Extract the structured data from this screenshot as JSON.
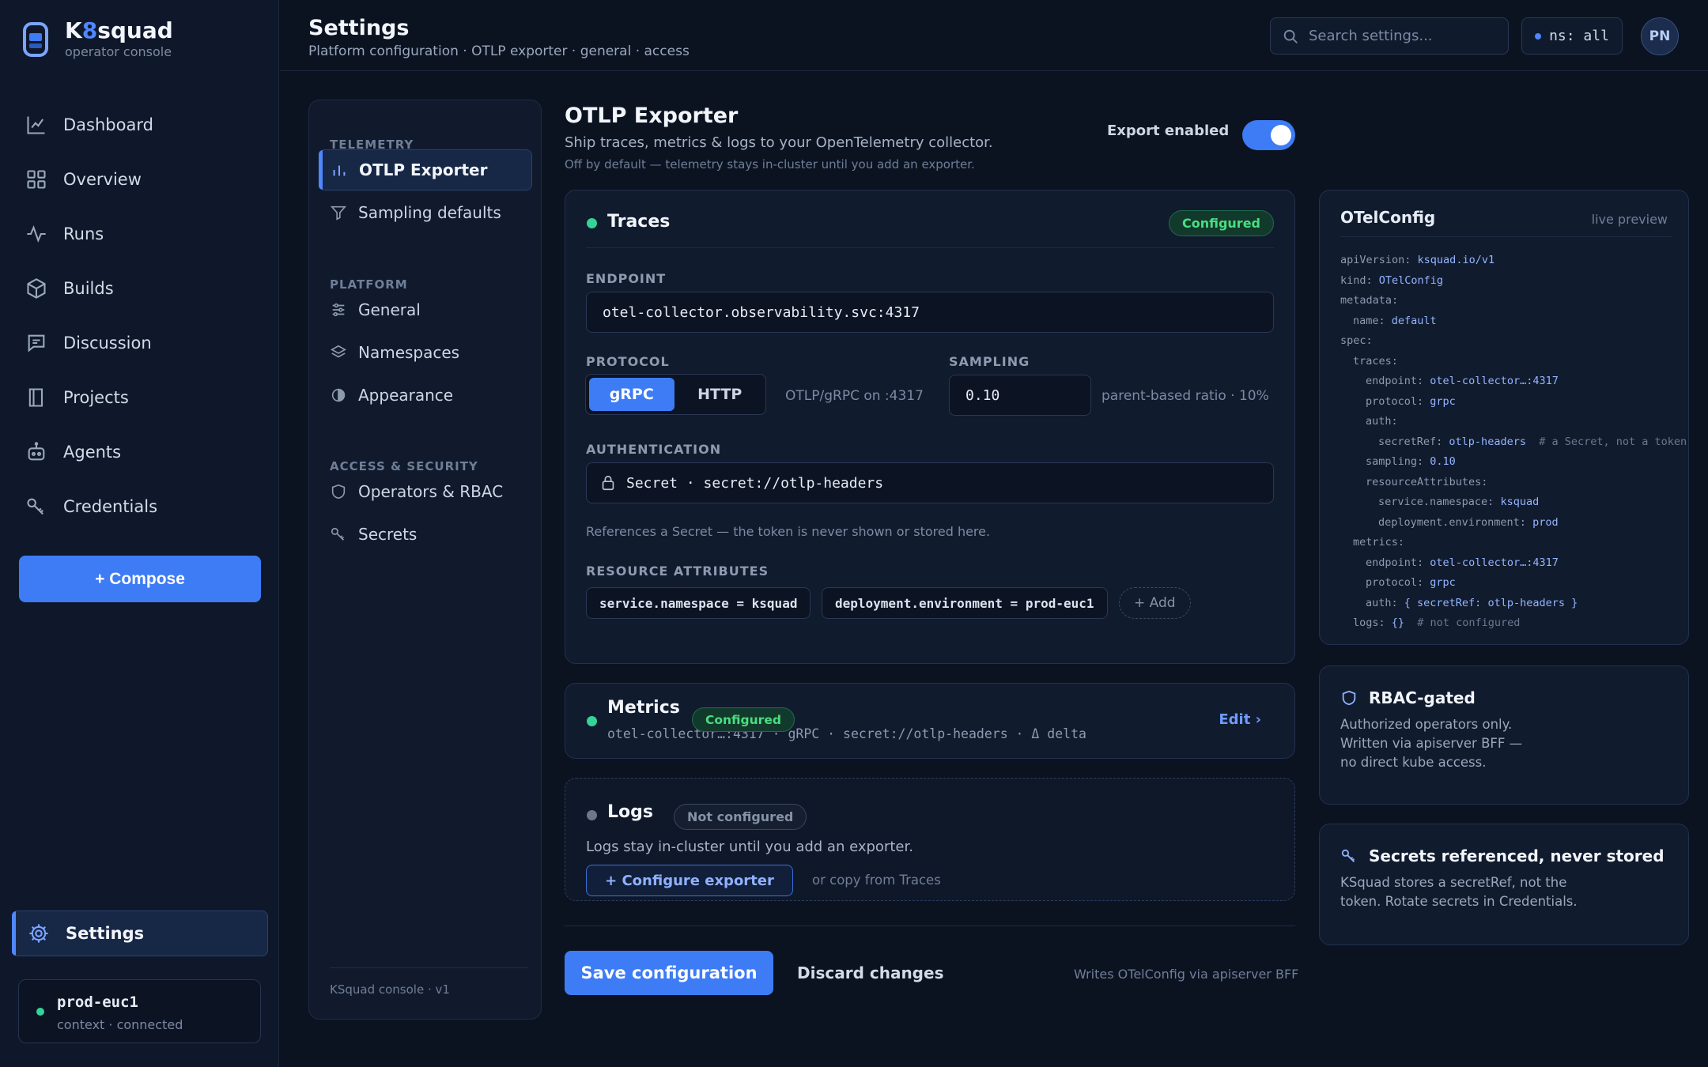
{
  "brand": {
    "name_a": "K",
    "name_accent": "8",
    "name_b": "squad",
    "subtitle": "operator console"
  },
  "nav": {
    "items": [
      {
        "label": "Dashboard",
        "icon": "chart-line-icon"
      },
      {
        "label": "Overview",
        "icon": "grid-icon"
      },
      {
        "label": "Runs",
        "icon": "activity-icon"
      },
      {
        "label": "Builds",
        "icon": "box-icon"
      },
      {
        "label": "Discussion",
        "icon": "message-icon"
      },
      {
        "label": "Projects",
        "icon": "book-icon"
      },
      {
        "label": "Agents",
        "icon": "bot-icon"
      },
      {
        "label": "Credentials",
        "icon": "key-icon"
      }
    ],
    "compose_label": "+ Compose",
    "settings_label": "Settings"
  },
  "context": {
    "name": "prod-euc1",
    "status": "context · connected"
  },
  "header": {
    "title": "Settings",
    "breadcrumb": "Platform configuration · OTLP exporter · general · access",
    "search_placeholder": "Search settings...",
    "ns_label": "ns: all",
    "avatar_initials": "PN"
  },
  "subnav": {
    "sections": [
      {
        "title": "TELEMETRY",
        "items": [
          "OTLP Exporter",
          "Sampling defaults"
        ]
      },
      {
        "title": "PLATFORM",
        "items": [
          "General",
          "Namespaces",
          "Appearance"
        ]
      },
      {
        "title": "ACCESS & SECURITY",
        "items": [
          "Operators & RBAC",
          "Secrets"
        ]
      }
    ],
    "footer": "KSquad console · v1"
  },
  "section": {
    "title": "OTLP Exporter",
    "subtitle": "Ship traces, metrics & logs to your OpenTelemetry collector.",
    "note": "Off by default — telemetry stays in-cluster until you add an exporter.",
    "export_label": "Export enabled",
    "export_enabled": true
  },
  "traces": {
    "title": "Traces",
    "status": "Configured",
    "endpoint_label": "ENDPOINT",
    "endpoint": "otel-collector.observability.svc:4317",
    "protocol_label": "PROTOCOL",
    "protocol_options": [
      "gRPC",
      "HTTP"
    ],
    "protocol_selected": "gRPC",
    "protocol_hint": "OTLP/gRPC on :4317",
    "sampling_label": "SAMPLING",
    "sampling_value": "0.10",
    "sampling_hint": "parent-based ratio · 10%",
    "auth_label": "AUTHENTICATION",
    "auth_value": "Secret · secret://otlp-headers",
    "auth_hint": "References a Secret — the token is never shown or stored here.",
    "attrs_label": "RESOURCE ATTRIBUTES",
    "attrs": [
      "service.namespace = ksquad",
      "deployment.environment = prod-euc1"
    ],
    "add_label": "+ Add"
  },
  "metrics": {
    "title": "Metrics",
    "status": "Configured",
    "summary": "otel-collector…:4317 · gRPC · secret://otlp-headers · Δ delta",
    "edit_label": "Edit ›"
  },
  "logs": {
    "title": "Logs",
    "status": "Not configured",
    "text": "Logs stay in-cluster until you add an exporter.",
    "configure_label": "+ Configure exporter",
    "copy_hint": "or copy from Traces"
  },
  "actions": {
    "save_label": "Save configuration",
    "discard_label": "Discard changes",
    "note": "Writes OTelConfig via apiserver BFF"
  },
  "preview": {
    "title": "OTelConfig",
    "live_label": "live preview",
    "lines": [
      {
        "indent": 0,
        "key": "apiVersion:",
        "value": "ksquad.io/v1",
        "comment": ""
      },
      {
        "indent": 0,
        "key": "kind:",
        "value": "OTelConfig",
        "comment": ""
      },
      {
        "indent": 0,
        "key": "metadata:",
        "value": "",
        "comment": ""
      },
      {
        "indent": 1,
        "key": "name:",
        "value": "default",
        "comment": ""
      },
      {
        "indent": 0,
        "key": "spec:",
        "value": "",
        "comment": ""
      },
      {
        "indent": 1,
        "key": "traces:",
        "value": "",
        "comment": ""
      },
      {
        "indent": 2,
        "key": "endpoint:",
        "value": "otel-collector…:4317",
        "comment": ""
      },
      {
        "indent": 2,
        "key": "protocol:",
        "value": "grpc",
        "comment": ""
      },
      {
        "indent": 2,
        "key": "auth:",
        "value": "",
        "comment": ""
      },
      {
        "indent": 3,
        "key": "secretRef:",
        "value": "otlp-headers",
        "comment": "  # a Secret, not a token"
      },
      {
        "indent": 2,
        "key": "sampling:",
        "value": "0.10",
        "comment": ""
      },
      {
        "indent": 2,
        "key": "resourceAttributes:",
        "value": "",
        "comment": ""
      },
      {
        "indent": 3,
        "key": "service.namespace:",
        "value": "ksquad",
        "comment": ""
      },
      {
        "indent": 3,
        "key": "deployment.environment:",
        "value": "prod",
        "comment": ""
      },
      {
        "indent": 1,
        "key": "metrics:",
        "value": "",
        "comment": ""
      },
      {
        "indent": 2,
        "key": "endpoint:",
        "value": "otel-collector…:4317",
        "comment": ""
      },
      {
        "indent": 2,
        "key": "protocol:",
        "value": "grpc",
        "comment": ""
      },
      {
        "indent": 2,
        "key": "auth:",
        "value": "{ secretRef: otlp-headers }",
        "comment": ""
      },
      {
        "indent": 1,
        "key": "logs:",
        "value": "{}",
        "comment": "  # not configured"
      }
    ]
  },
  "rbac": {
    "title": "RBAC-gated",
    "lines": [
      "Authorized operators only.",
      "Written via apiserver BFF —",
      "no direct kube access."
    ]
  },
  "secrets_info": {
    "title": "Secrets referenced, never stored",
    "lines": [
      "KSquad stores a secretRef, not the",
      "token. Rotate secrets in Credentials."
    ]
  },
  "colors": {
    "accent": "#3d7cf5",
    "ok": "#34d399",
    "bg": "#0b1321"
  }
}
